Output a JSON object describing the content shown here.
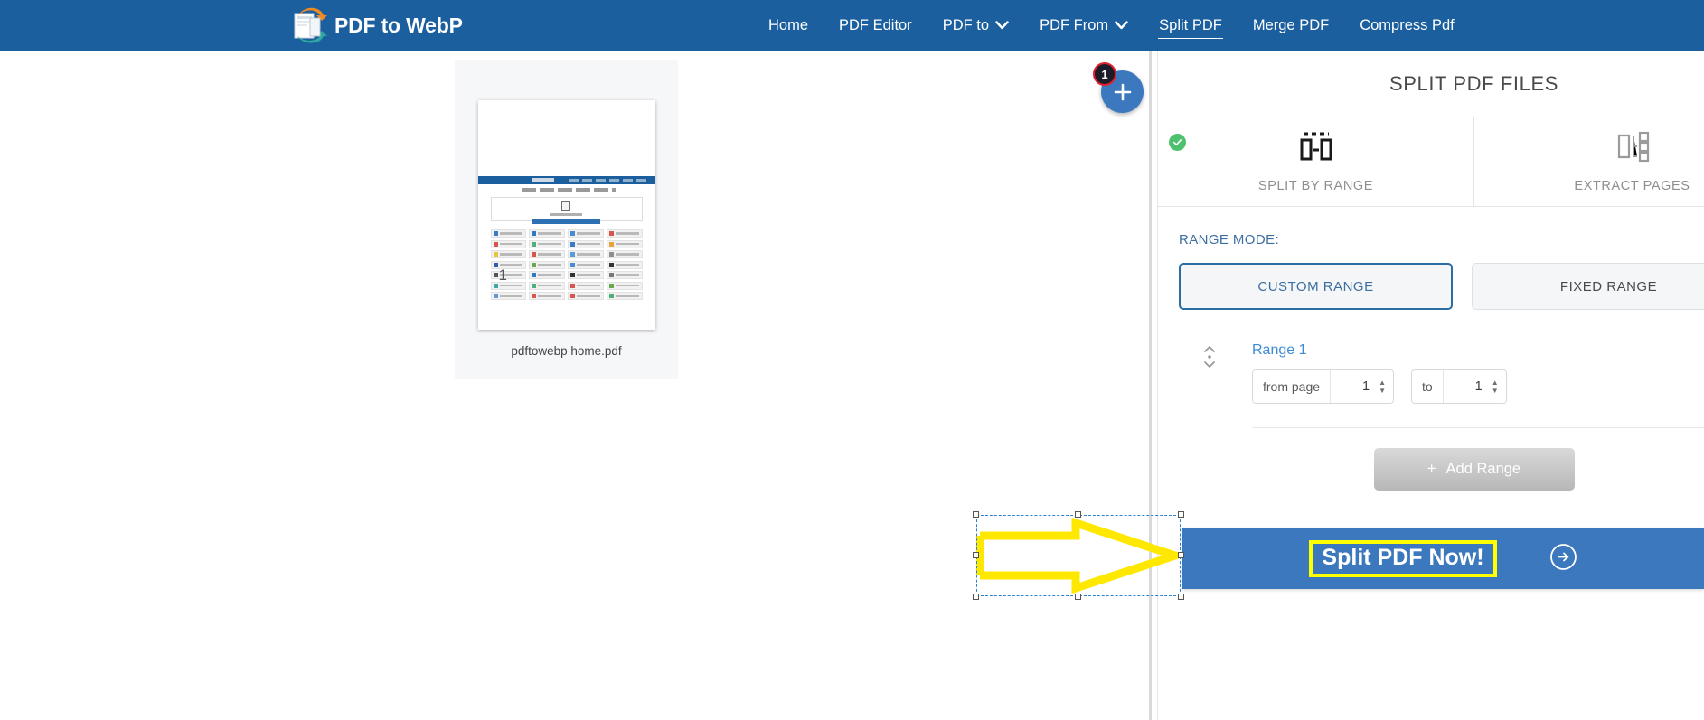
{
  "nav": {
    "brand": "PDF to WebP",
    "brand_icon": "pdf-to-webp-logo-icon",
    "items": [
      {
        "label": "Home",
        "has_caret": false,
        "active": false
      },
      {
        "label": "PDF Editor",
        "has_caret": false,
        "active": false
      },
      {
        "label": "PDF to",
        "has_caret": true,
        "active": false
      },
      {
        "label": "PDF From",
        "has_caret": true,
        "active": false
      },
      {
        "label": "Split PDF",
        "has_caret": false,
        "active": true
      },
      {
        "label": "Merge PDF",
        "has_caret": false,
        "active": false
      },
      {
        "label": "Compress Pdf",
        "has_caret": false,
        "active": false
      }
    ],
    "caret_glyph": "∨",
    "bg_color": "#1b5f9e"
  },
  "workspace": {
    "thumbnail": {
      "page_number": "1",
      "filename": "pdftowebp home.pdf"
    },
    "add_file_button": {
      "icon": "plus-icon",
      "badge_count": "1",
      "badge_ring_color": "#e0202c",
      "button_color": "#3c78bd"
    }
  },
  "panel": {
    "title": "SPLIT PDF FILES",
    "tabs": [
      {
        "label": "SPLIT BY RANGE",
        "icon": "split-by-range-icon",
        "selected": true,
        "check_color": "#4ec16f"
      },
      {
        "label": "EXTRACT PAGES",
        "icon": "extract-pages-icon",
        "selected": false
      }
    ],
    "range_mode": {
      "label": "RANGE MODE:",
      "options": [
        {
          "label": "CUSTOM RANGE",
          "active": true
        },
        {
          "label": "FIXED RANGE",
          "active": false
        }
      ],
      "accent_color": "#2b6ca3"
    },
    "range": {
      "name": "Range 1",
      "from_label": "from page",
      "from_value": "1",
      "to_label": "to",
      "to_value": "1",
      "reorder_icon": "up-down-reorder-icon"
    },
    "add_range_button": {
      "label": "Add Range",
      "icon": "plus-icon"
    },
    "cta": {
      "label": "Split PDF Now!",
      "icon": "arrow-right-circle-icon",
      "bg_color": "#3c78bd",
      "highlight_color": "#ffff00"
    }
  },
  "annotation": {
    "shape": "yellow-arrow-right",
    "stroke_color": "#ffe800",
    "selection_color": "#2b7fd4",
    "selected": true
  }
}
